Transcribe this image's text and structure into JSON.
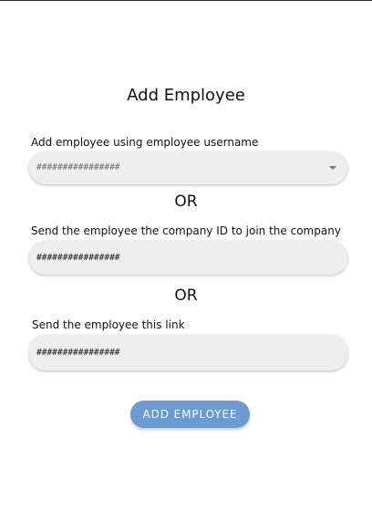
{
  "page": {
    "title": "Add Employee",
    "separator_text": "OR"
  },
  "by_username": {
    "label": "Add employee using employee username",
    "value": "################"
  },
  "by_company_id": {
    "label": "Send the employee the company ID to join the company",
    "value": "################"
  },
  "by_link": {
    "label": "Send the employee this link",
    "value": "################"
  },
  "actions": {
    "add_employee_label": "ADD EMPLOYEE"
  },
  "colors": {
    "button_background": "#6c9bd1",
    "field_background": "#eeeeee"
  }
}
